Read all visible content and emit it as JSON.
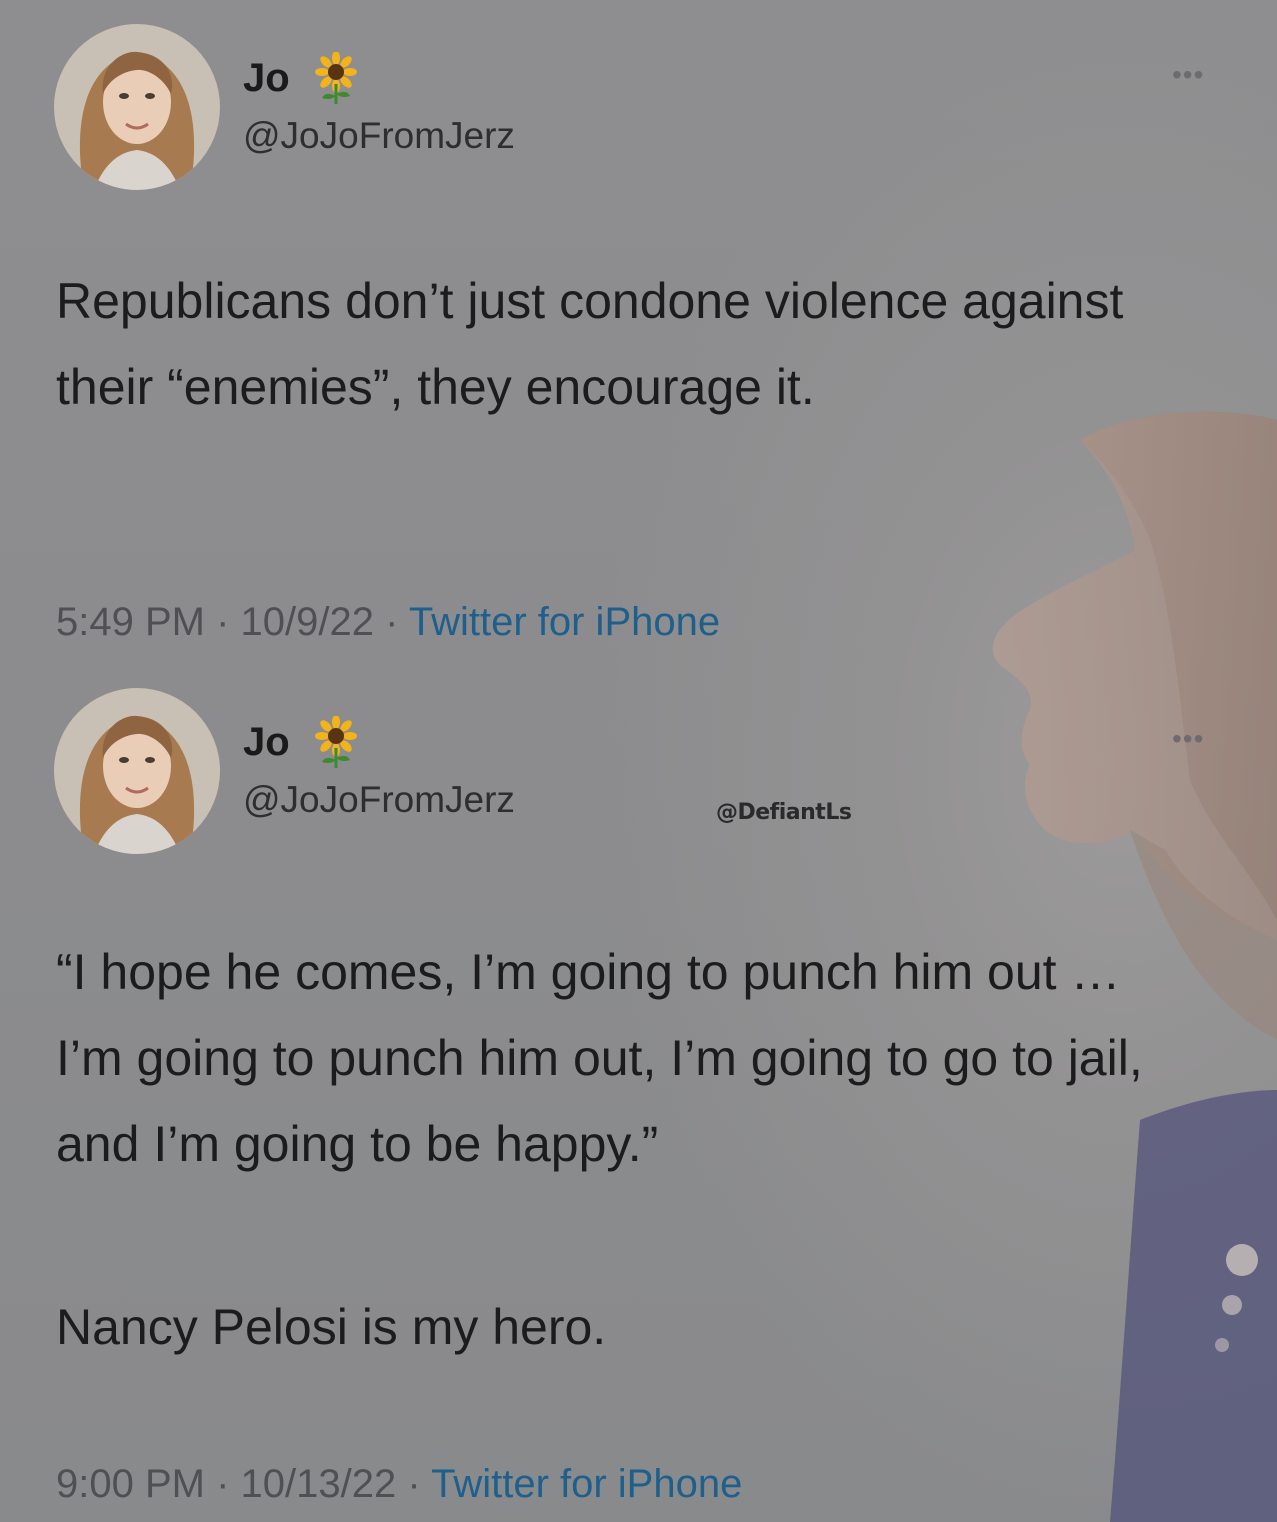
{
  "tweets": [
    {
      "display_name": "Jo",
      "handle": "@JoJoFromJerz",
      "name_emoji": "sunflower-icon",
      "text": "Republicans don’t just condone violence against their “enemies”, they encourage it.",
      "time": "5:49 PM",
      "date": "10/9/22",
      "source": "Twitter for iPhone"
    },
    {
      "display_name": "Jo",
      "handle": "@JoJoFromJerz",
      "name_emoji": "sunflower-icon",
      "text": "“I hope he comes, I’m going to punch him out … I’m going to punch him out, I’m going to go to jail, and I’m going to be happy.”",
      "text_2": "Nancy Pelosi is my hero.",
      "time": "9:00 PM",
      "date": "10/13/22",
      "source": "Twitter for iPhone"
    }
  ],
  "watermark": "@DefiantLs",
  "separator": "·",
  "colors": {
    "background": "#8c8c8e",
    "link": "#1e5f8c",
    "text": "#1c1c1e"
  }
}
